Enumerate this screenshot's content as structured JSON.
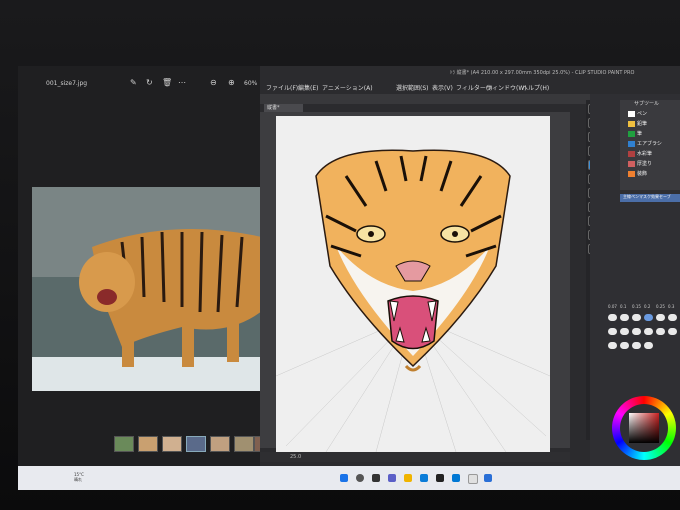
{
  "viewer": {
    "filename": "001_size7.jpg",
    "zoom": "60%",
    "toolbar_icons": [
      "edit-icon",
      "rotate-icon",
      "delete-icon",
      "more-icon",
      "zoom-out-icon",
      "zoom-in-icon"
    ]
  },
  "csp": {
    "title": "ﾄﾗ 縦書* (A4 210.00 x 297.00mm 350dpi 25.0%) - CLIP STUDIO PAINT PRO",
    "menu": [
      "ファイル(F)",
      "編集(E)",
      "アニメーション(A)",
      "選択範囲(S)",
      "表示(V)",
      "フィルター(I)",
      "ウィンドウ(W)",
      "ヘルプ(H)"
    ],
    "doc_tab": "縦書*",
    "status": "25.0",
    "subtool_header": "サブツール",
    "subtools": [
      {
        "label": "ペン",
        "color": "#ffffff"
      },
      {
        "label": "鉛筆",
        "color": "#f0c040"
      },
      {
        "label": "筆",
        "color": "#20a040"
      },
      {
        "label": "エアブラシ",
        "color": "#3080d0"
      },
      {
        "label": "水彩筆",
        "color": "#b04040"
      },
      {
        "label": "厚塗り",
        "color": "#d06060"
      },
      {
        "label": "装飾",
        "color": "#f08030"
      }
    ],
    "selected_subtool": "主線ペンマスク効果セーブ",
    "brush_sizes": [
      "0.07",
      "0.1",
      "0.15",
      "0.2",
      "0.25",
      "0.3"
    ]
  },
  "taskbar": {
    "weather_temp": "15°C",
    "weather_desc": "晴れ"
  }
}
